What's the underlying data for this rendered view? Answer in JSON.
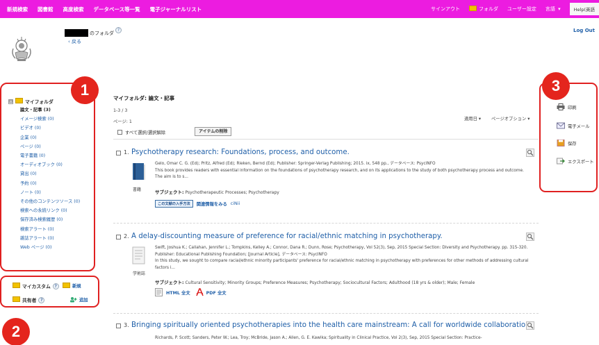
{
  "topbar": {
    "nav": [
      "新規検索",
      "図書館",
      "高度検索",
      "データベース等一覧",
      "電子ジャーナルリスト"
    ],
    "signout": "サインアウト",
    "folder": "フォルダ",
    "user_settings": "ユーザー設定",
    "language": "言語",
    "language_caret": "▾",
    "help": "Help(英語"
  },
  "header": {
    "folder_of": "のフォルダ",
    "help_mark": "?",
    "back": "‹ 戻る",
    "logout": "Log Out"
  },
  "sidebar": {
    "expander": "⊟",
    "root": "マイフォルダ",
    "items": [
      {
        "label": "論文・記事",
        "count": "(3)"
      },
      {
        "label": "イメージ検索",
        "count": "(0)"
      },
      {
        "label": "ビデオ",
        "count": "(0)"
      },
      {
        "label": "企業",
        "count": "(0)"
      },
      {
        "label": "ページ",
        "count": "(0)"
      },
      {
        "label": "電子書籍",
        "count": "(0)"
      },
      {
        "label": "オーディオブック",
        "count": "(0)"
      },
      {
        "label": "貸出",
        "count": "(0)"
      },
      {
        "label": "予約",
        "count": "(0)"
      },
      {
        "label": "ノート",
        "count": "(0)"
      },
      {
        "label": "その他のコンテンツソース",
        "count": "(0)"
      },
      {
        "label": "検索への永続リンク",
        "count": "(0)"
      },
      {
        "label": "保存済み検索履歴",
        "count": "(0)"
      },
      {
        "label": "検索アラート",
        "count": "(0)"
      },
      {
        "label": "雑誌アラート",
        "count": "(0)"
      },
      {
        "label": "Web ページ",
        "count": "(0)"
      }
    ],
    "custom_folders": "マイカスタム",
    "new": "新規",
    "shared": "共有者",
    "add": "追加"
  },
  "badges": [
    "1",
    "2",
    "3"
  ],
  "main": {
    "title": "マイフォルダ: 論文・記事",
    "count": "1-3 / 3",
    "page": "ページ: 1",
    "sort": "適用日 ▾",
    "page_options": "ページオプション ▾",
    "select_all": "すべて選択/選択解除",
    "delete_items": "アイテムの削除"
  },
  "results": [
    {
      "num": "1.",
      "title": "Psychotherapy research: Foundations, process, and outcome.",
      "meta": "Gelo, Omar C. G. (Ed); Pritz, Alfred (Ed); Rieken, Bernd (Ed); Publisher: Springer-Verlag Publishing; 2015. ix, 548 pp., データベース: PsycINFO",
      "abstract": "This book provides readers with essential information on the foundations of psychotherapy research, and on its applications to the study of both psychotherapy process and outcome. The aim is to s...",
      "type": "書籍",
      "subject_label": "サブジェクト:",
      "subjects": "Psychotherapeutic Processes; Psychotherapy",
      "findit": "この文献の入手方法",
      "related": "関連情報をみる",
      "cinii": "ciNii"
    },
    {
      "num": "2.",
      "title": "A delay-discounting measure of preference for racial/ethnic matching in psychotherapy.",
      "meta": "Swift, Joshua K.; Callahan, Jennifer L.; Tompkins, Kelley A.; Connor, Dana R.; Dunn, Rose; Psychotherapy, Vol 52(3), Sep, 2015 Special Section: Diversity and Psychotherapy. pp. 315-320. Publisher: Educational Publishing Foundation; [Journal Article], データベース: PsycINFO",
      "abstract": "In this study, we sought to compare racial/ethnic minority participants' preference for racial/ethnic matching in psychotherapy with preferences for other methods of addressing cultural factors i...",
      "type": "学術誌",
      "subject_label": "サブジェクト:",
      "subjects": "Cultural Sensitivity; Minority Groups; Preference Measures; Psychotherapy; Sociocultural Factors; Adulthood (18 yrs & older); Male; Female",
      "html": "HTML 全文",
      "pdf": "PDF 全文"
    },
    {
      "num": "3.",
      "title": "Bringing spiritually oriented psychotherapies into the health care mainstream: A call for worldwide collaboration.",
      "meta": "Richards, P. Scott; Sanders, Peter W.; Lea, Troy; McBride, Jason A.; Allen, G. E. Kawika; Spirituality in Clinical Practice, Vol 2(3), Sep, 2015 Special Section: Practice-"
    }
  ],
  "right_panel": {
    "print": "印刷",
    "email": "電子メール",
    "save": "保存",
    "export": "エクスポート"
  }
}
